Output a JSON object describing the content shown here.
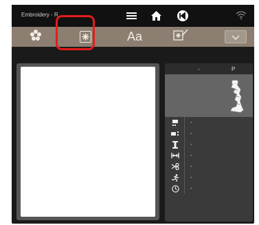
{
  "status_bar": {
    "app_title": "Embroidery - R",
    "icons": [
      "menu-icon",
      "home-icon",
      "back-icon",
      "wifi-icon"
    ]
  },
  "toolbar": {
    "text_label": "Aa",
    "buttons": [
      "flower-icon",
      "embroidery-select-icon",
      "text-icon",
      "edit-embroidery-icon",
      "chevron-down-icon"
    ],
    "highlighted_button": "embroidery-select-icon",
    "highlight_color": "#e61b1b"
  },
  "panel": {
    "header_left": "-",
    "header_right": "P",
    "rows": [
      {
        "icon": "stitch-count-icon",
        "value": "-"
      },
      {
        "icon": "color-count-icon",
        "value": "-"
      },
      {
        "icon": "height-icon",
        "value": "-"
      },
      {
        "icon": "width-icon",
        "value": "-"
      },
      {
        "icon": "scissors-icon",
        "value": "-"
      },
      {
        "icon": "runner-icon",
        "value": "-"
      },
      {
        "icon": "clock-icon",
        "value": "-"
      }
    ]
  },
  "colors": {
    "toolbar_bg": "#8c7e70",
    "panel_bg": "#3a3a3a",
    "device_bg": "#1a1a1a"
  }
}
